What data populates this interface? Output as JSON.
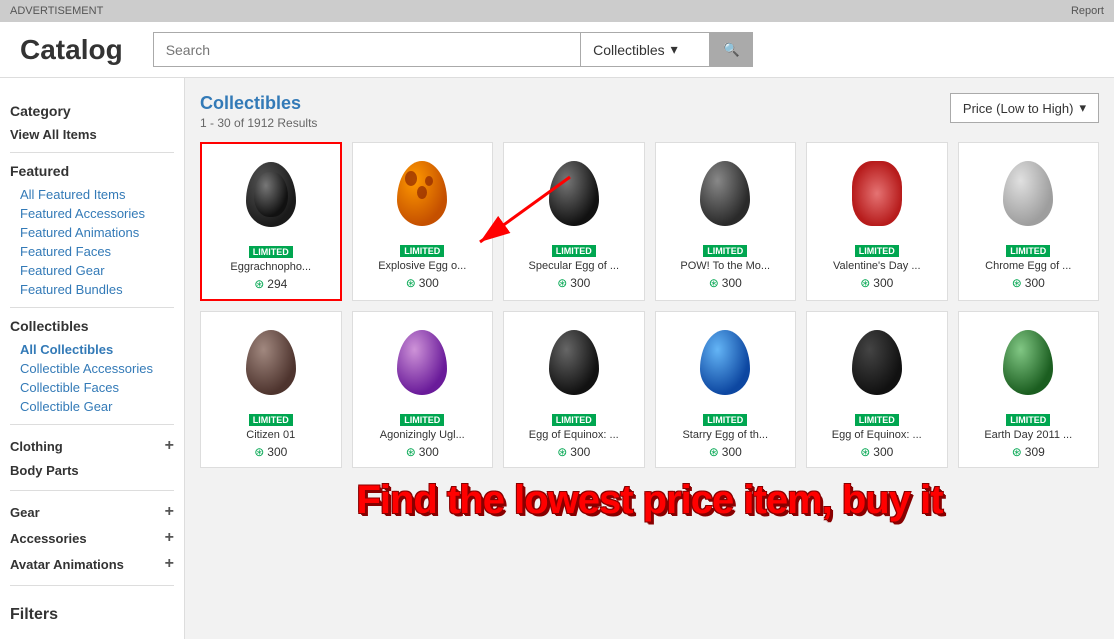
{
  "adBar": {
    "advertisement": "ADVERTISEMENT",
    "report": "Report"
  },
  "header": {
    "title": "Catalog",
    "searchPlaceholder": "Search",
    "dropdownLabel": "Collectibles",
    "searchIcon": "🔍"
  },
  "sidebar": {
    "categoryTitle": "Category",
    "viewAllItems": "View All Items",
    "featuredTitle": "Featured",
    "featuredItems": "All Featured Items",
    "featuredAccessories": "Featured Accessories",
    "featuredAnimations": "Featured Animations",
    "featuredFaces": "Featured Faces",
    "featuredGear": "Featured Gear",
    "featuredBundles": "Featured Bundles",
    "collectiblesTitle": "Collectibles",
    "allCollectibles": "All Collectibles",
    "collectibleAccessories": "Collectible Accessories",
    "collectibleFaces": "Collectible Faces",
    "collectibleGear": "Collectible Gear",
    "clothingTitle": "Clothing",
    "bodyPartsTitle": "Body Parts",
    "gearTitle": "Gear",
    "accessoriesTitle": "Accessories",
    "avatarAnimationsTitle": "Avatar Animations",
    "filtersTitle": "Filters"
  },
  "content": {
    "title": "Collectibles",
    "resultsCount": "1 - 30 of 1912 Results",
    "sortLabel": "Price (Low to High)"
  },
  "items": [
    {
      "id": 1,
      "name": "Eggrachnopho...",
      "price": "294",
      "badge": "LIMITED",
      "selected": true,
      "color": "#222",
      "spotColor": null
    },
    {
      "id": 2,
      "name": "Explosive Egg o...",
      "price": "300",
      "badge": "LIMITED",
      "color": "#c55000",
      "spotColor": "#8B0000"
    },
    {
      "id": 3,
      "name": "Specular Egg of ...",
      "price": "300",
      "badge": "LIMITED",
      "color": "#111",
      "spotColor": "#fff"
    },
    {
      "id": 4,
      "name": "POW! To the Mo...",
      "price": "300",
      "badge": "LIMITED",
      "color": "#333"
    },
    {
      "id": 5,
      "name": "Valentine's Day ...",
      "price": "300",
      "badge": "LIMITED",
      "color": "#c0392b"
    },
    {
      "id": 6,
      "name": "Chrome Egg of ...",
      "price": "300",
      "badge": "LIMITED",
      "color": "#aaa"
    },
    {
      "id": 7,
      "name": "Citizen 01",
      "price": "300",
      "badge": "LIMITED",
      "color": "#5d4037"
    },
    {
      "id": 8,
      "name": "Agonizingly Ugl...",
      "price": "300",
      "badge": "LIMITED",
      "color": "#7b1fa2"
    },
    {
      "id": 9,
      "name": "Egg of Equinox: ...",
      "price": "300",
      "badge": "LIMITED",
      "color": "#111"
    },
    {
      "id": 10,
      "name": "Starry Egg of th...",
      "price": "300",
      "badge": "LIMITED",
      "color": "#0d47a1"
    },
    {
      "id": 11,
      "name": "Egg of Equinox: ...",
      "price": "300",
      "badge": "LIMITED",
      "color": "#1a1a1a"
    },
    {
      "id": 12,
      "name": "Earth Day 2011 ...",
      "price": "309",
      "badge": "LIMITED",
      "color": "#2e7d32"
    }
  ],
  "overlayText": "Find the lowest price item, buy it"
}
